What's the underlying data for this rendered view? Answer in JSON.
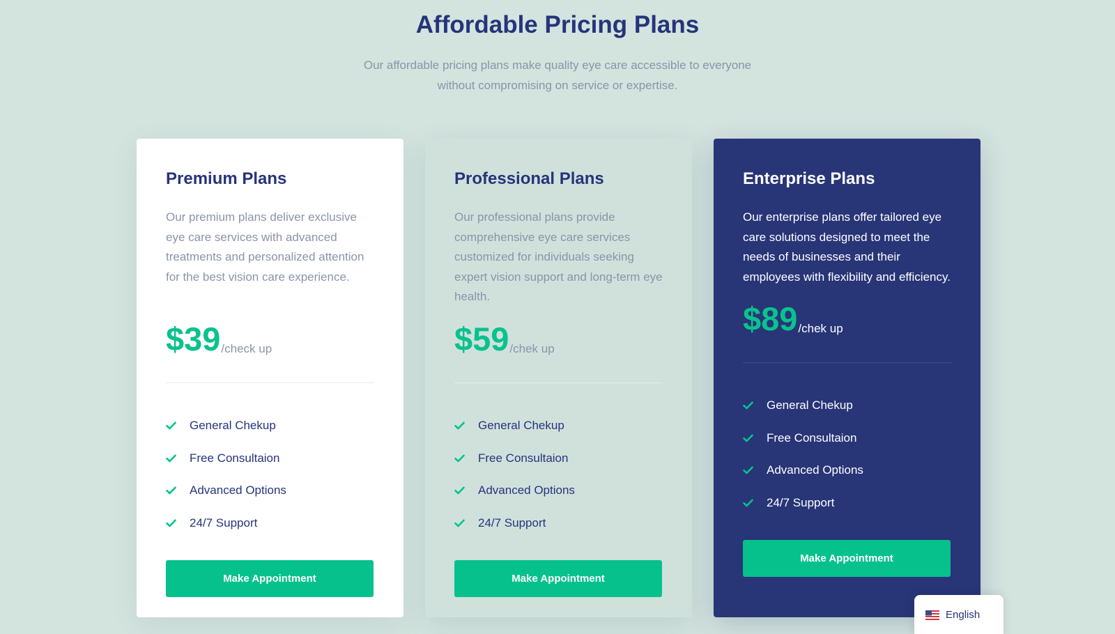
{
  "header": {
    "title": "Affordable Pricing Plans",
    "subtitle": "Our affordable pricing plans make quality eye care accessible to everyone without compromising on service or expertise."
  },
  "colors": {
    "background": "#d3e4df",
    "navy": "#26347a",
    "accent_green": "#07c18d",
    "muted_text": "#8a94a8",
    "enterprise_card": "#283577"
  },
  "plans": [
    {
      "name": "Premium Plans",
      "description": "Our premium plans deliver exclusive eye care services with advanced treatments and personalized attention for the best vision care experience.",
      "price": "$39",
      "unit": "/check up",
      "features": [
        "General Chekup",
        "Free Consultaion",
        "Advanced Options",
        "24/7 Support"
      ],
      "button_label": "Make Appointment"
    },
    {
      "name": "Professional Plans",
      "description": "Our professional plans provide comprehensive eye care services customized for individuals seeking expert vision support and long-term eye health.",
      "price": "$59",
      "unit": "/chek up",
      "features": [
        "General Chekup",
        "Free Consultaion",
        "Advanced Options",
        "24/7 Support"
      ],
      "button_label": "Make Appointment"
    },
    {
      "name": "Enterprise Plans",
      "description": "Our enterprise plans offer tailored eye care solutions designed to meet the needs of businesses and their employees with flexibility and efficiency.",
      "price": "$89",
      "unit": "/chek up",
      "features": [
        "General Chekup",
        "Free Consultaion",
        "Advanced Options",
        "24/7 Support"
      ],
      "button_label": "Make Appointment"
    }
  ],
  "language_switcher": {
    "label": "English",
    "icon": "us-flag-icon"
  }
}
